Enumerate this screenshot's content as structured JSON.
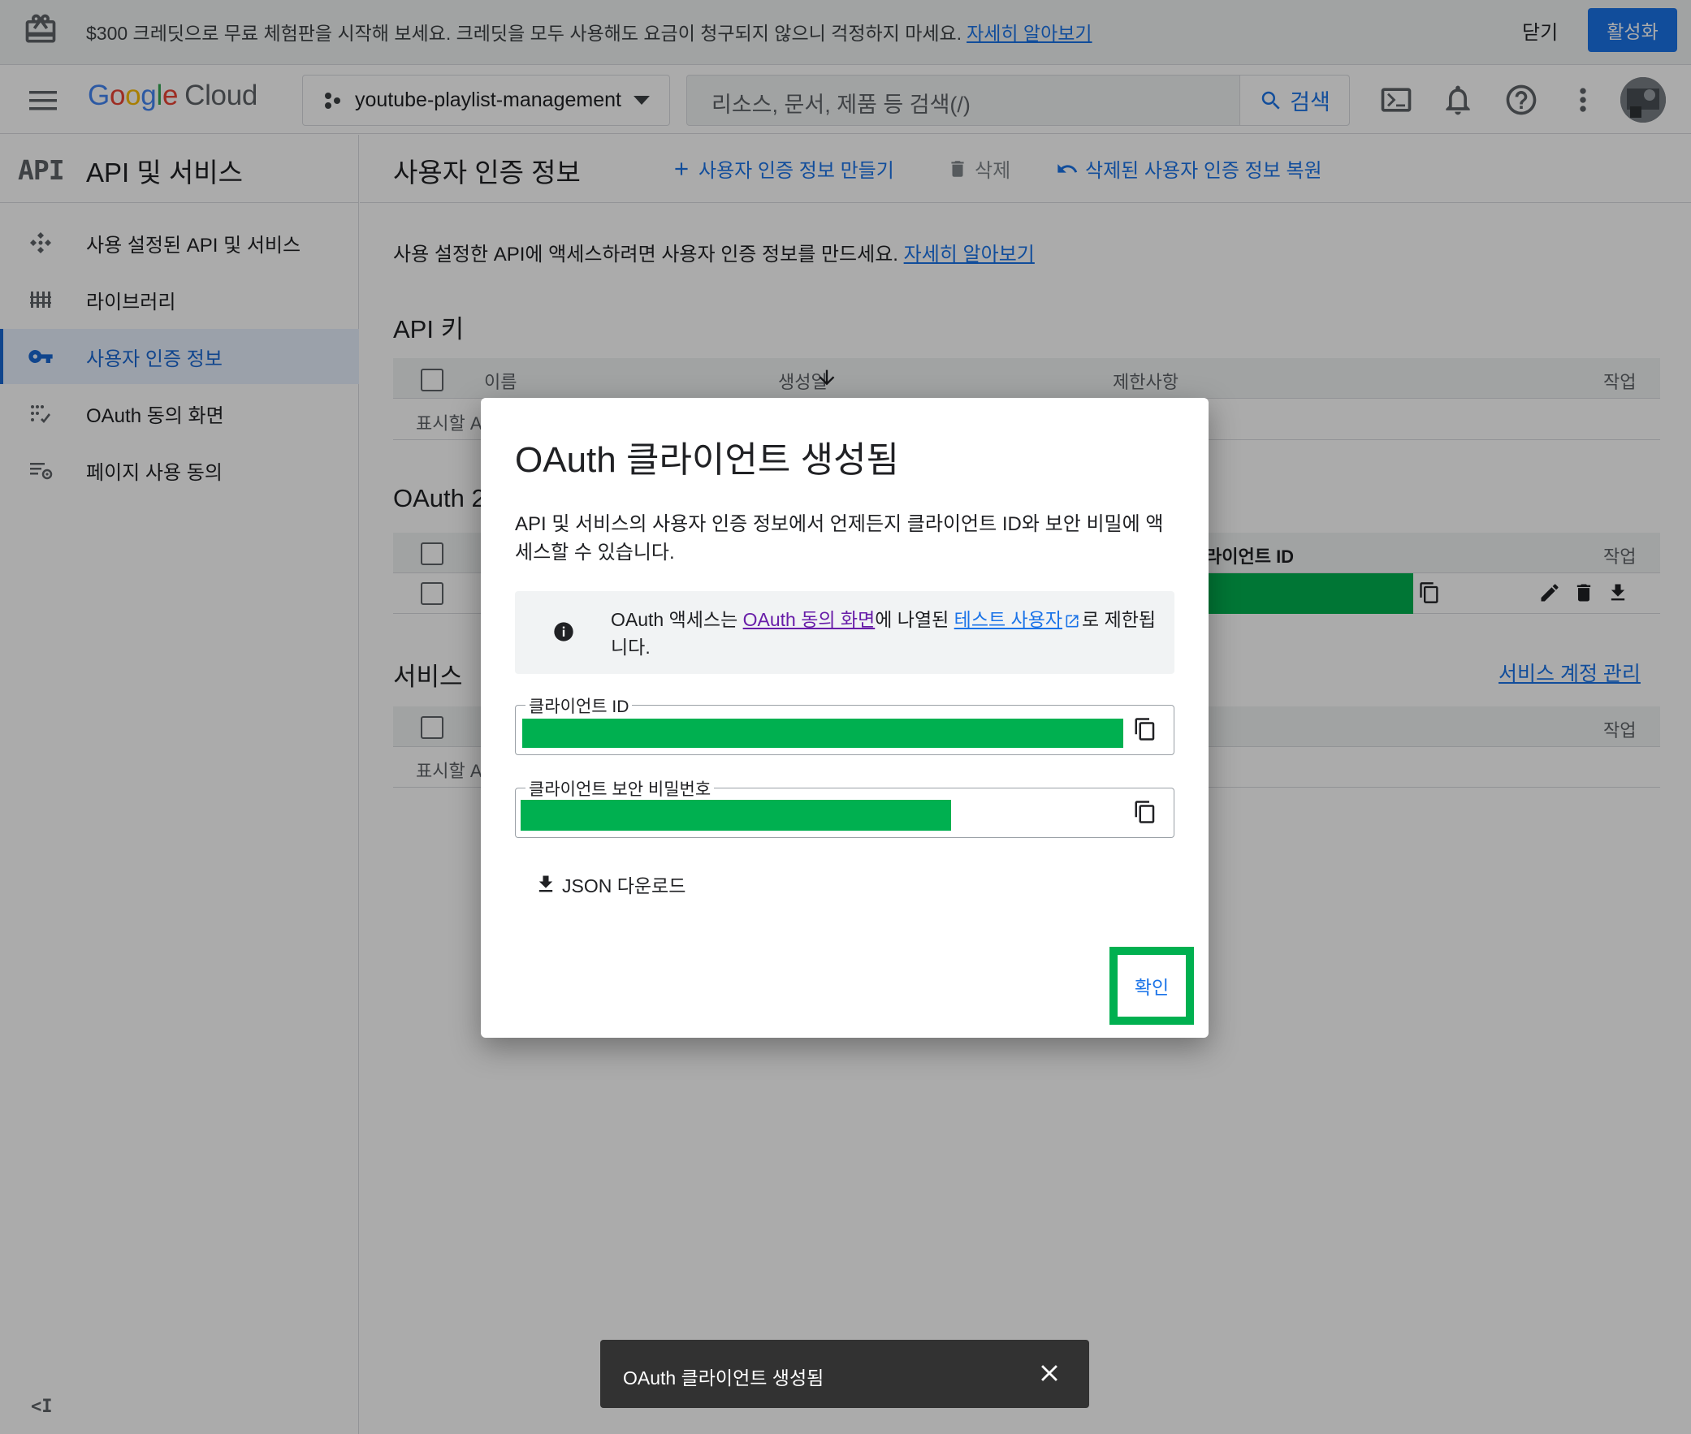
{
  "banner": {
    "text": "$300 크레딧으로 무료 체험판을 시작해 보세요. 크레딧을 모두 사용해도 요금이 청구되지 않으니 걱정하지 마세요.",
    "link": "자세히 알아보기",
    "close": "닫기",
    "activate": "활성화"
  },
  "header": {
    "logo_letters": [
      "G",
      "o",
      "o",
      "g",
      "l",
      "e"
    ],
    "logo_cloud": "Cloud",
    "project": "youtube-playlist-management",
    "search_placeholder": "리소스, 문서, 제품 등 검색(/)",
    "search_button": "검색"
  },
  "sidebar": {
    "badge": "API",
    "title": "API 및 서비스",
    "items": [
      {
        "label": "사용 설정된 API 및 서비스",
        "icon": "api-diamond-icon",
        "active": false
      },
      {
        "label": "라이브러리",
        "icon": "library-icon",
        "active": false
      },
      {
        "label": "사용자 인증 정보",
        "icon": "key-icon",
        "active": true
      },
      {
        "label": "OAuth 동의 화면",
        "icon": "consent-icon",
        "active": false
      },
      {
        "label": "페이지 사용 동의",
        "icon": "page-settings-icon",
        "active": false
      }
    ],
    "collapse": "<I"
  },
  "main": {
    "title": "사용자 인증 정보",
    "actions": {
      "create": "사용자 인증 정보 만들기",
      "delete": "삭제",
      "restore": "삭제된 사용자 인증 정보 복원"
    },
    "intro": "사용 설정한 API에 액세스하려면 사용자 인증 정보를 만드세요.",
    "intro_link": "자세히 알아보기",
    "api_keys": {
      "title": "API 키",
      "columns": [
        "이름",
        "생성일",
        "제한사항",
        "작업"
      ],
      "empty": "표시할 A"
    },
    "oauth": {
      "title": "OAuth 2",
      "client_id_col": "라이언트 ID",
      "actions_col": "작업"
    },
    "service_accounts": {
      "title": "서비스 ",
      "manage_link": "서비스 계정 관리",
      "actions_col": "작업",
      "empty": "표시할 A"
    }
  },
  "dialog": {
    "title": "OAuth 클라이언트 생성됨",
    "description": "API 및 서비스의 사용자 인증 정보에서 언제든지 클라이언트 ID와 보안 비밀에 액세스할 수 있습니다.",
    "info": {
      "prefix": "OAuth 액세스는 ",
      "link1": "OAuth 동의 화면",
      "middle": "에 나열된 ",
      "link2": "테스트 사용자",
      "suffix": "로 제한됩니다."
    },
    "client_id_label": "클라이언트 ID",
    "client_secret_label": "클라이언트 보안 비밀번호",
    "json_download": "JSON 다운로드",
    "ok": "확인"
  },
  "snackbar": {
    "text": "OAuth 클라이언트 생성됨"
  },
  "colors": {
    "accent": "#1a73e8",
    "redaction": "#00b050",
    "active_nav_bg": "#e8f0fe"
  }
}
